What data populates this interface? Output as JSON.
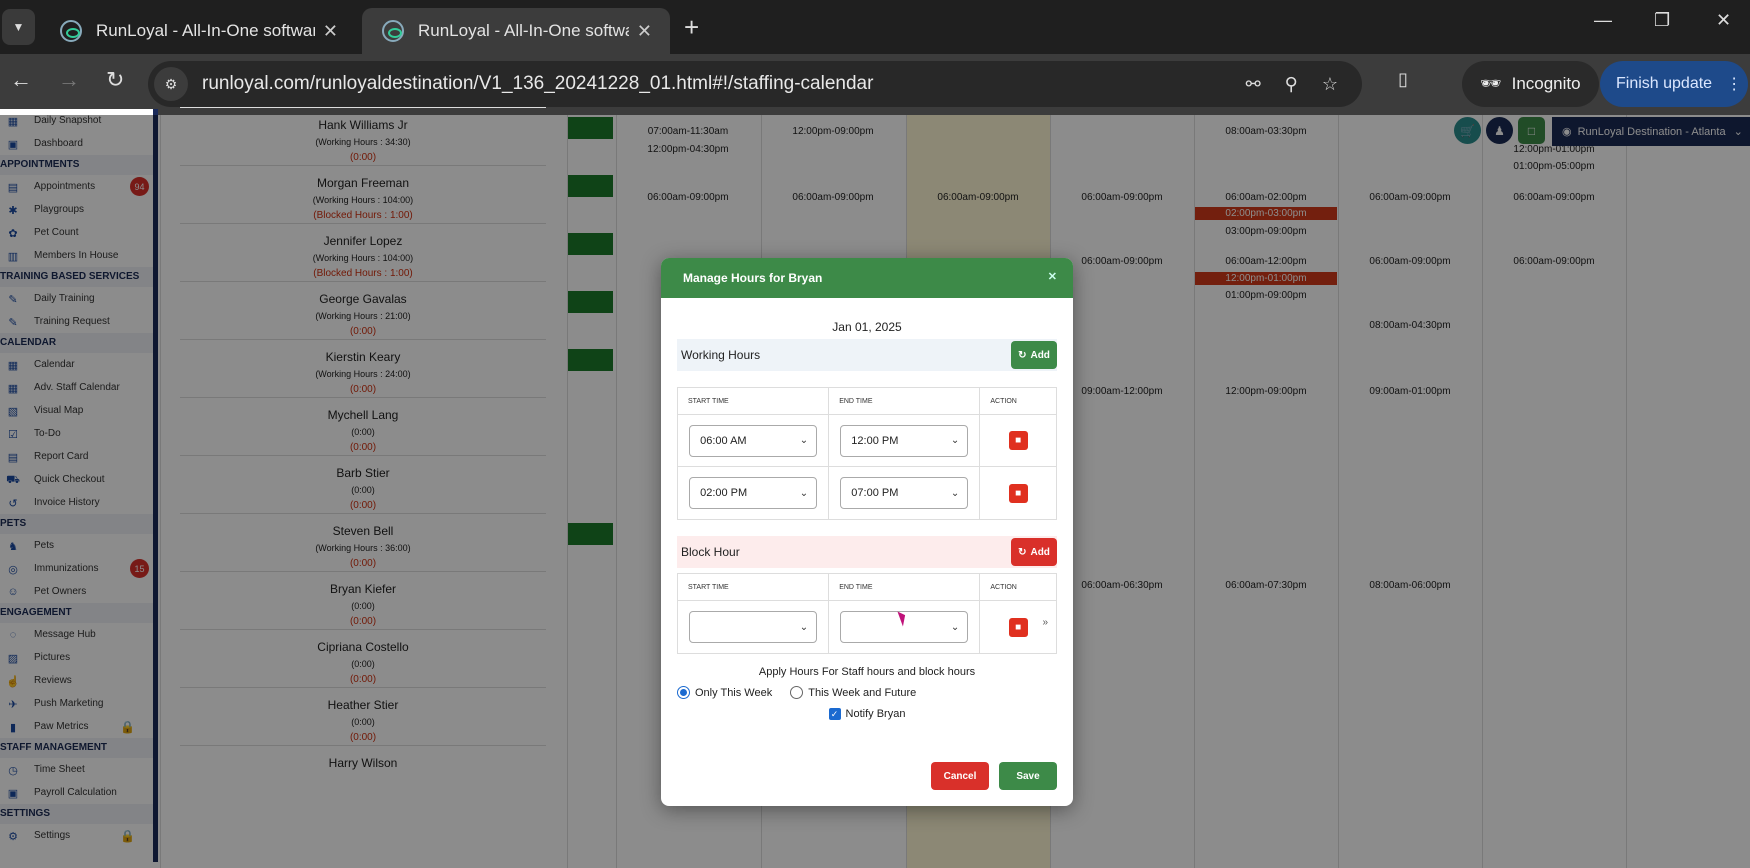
{
  "browser": {
    "tabs": [
      {
        "title": "RunLoyal - All-In-One software"
      },
      {
        "title": "RunLoyal - All-In-One software"
      }
    ],
    "url": "runloyal.com/runloyaldestination/V1_136_20241228_01.html#!/staffing-calendar",
    "incognito_label": "Incognito",
    "finish_update_label": "Finish update"
  },
  "location": "RunLoyal Destination - Atlanta",
  "sidebar": {
    "items": [
      {
        "label": "Daily Snapshot",
        "icon": "snapshot-icon"
      },
      {
        "label": "Dashboard",
        "icon": "dashboard-icon"
      },
      {
        "section": "APPOINTMENTS"
      },
      {
        "label": "Appointments",
        "icon": "appointments-icon",
        "badge": "94"
      },
      {
        "label": "Playgroups",
        "icon": "playgroups-icon"
      },
      {
        "label": "Pet Count",
        "icon": "pet-count-icon"
      },
      {
        "label": "Members In House",
        "icon": "members-icon"
      },
      {
        "section": "TRAINING BASED SERVICES"
      },
      {
        "label": "Daily Training",
        "icon": "training-icon"
      },
      {
        "label": "Training Request",
        "icon": "training-request-icon"
      },
      {
        "section": "CALENDAR"
      },
      {
        "label": "Calendar",
        "icon": "calendar-icon"
      },
      {
        "label": "Adv. Staff Calendar",
        "icon": "staff-calendar-icon"
      },
      {
        "label": "Visual Map",
        "icon": "map-icon"
      },
      {
        "label": "To-Do",
        "icon": "todo-icon"
      },
      {
        "label": "Report Card",
        "icon": "report-card-icon"
      },
      {
        "label": "Quick Checkout",
        "icon": "checkout-icon"
      },
      {
        "label": "Invoice History",
        "icon": "invoice-icon"
      },
      {
        "section": "PETS"
      },
      {
        "label": "Pets",
        "icon": "pets-icon"
      },
      {
        "label": "Immunizations",
        "icon": "immunizations-icon",
        "badge": "15"
      },
      {
        "label": "Pet Owners",
        "icon": "pet-owners-icon"
      },
      {
        "section": "ENGAGEMENT"
      },
      {
        "label": "Message Hub",
        "icon": "message-icon"
      },
      {
        "label": "Pictures",
        "icon": "pictures-icon"
      },
      {
        "label": "Reviews",
        "icon": "reviews-icon"
      },
      {
        "label": "Push Marketing",
        "icon": "marketing-icon"
      },
      {
        "label": "Paw Metrics",
        "icon": "metrics-icon",
        "locked": true
      },
      {
        "section": "STAFF MANAGEMENT"
      },
      {
        "label": "Time Sheet",
        "icon": "timesheet-icon"
      },
      {
        "label": "Payroll Calculation",
        "icon": "payroll-icon"
      },
      {
        "section": "SETTINGS"
      },
      {
        "label": "Settings",
        "icon": "settings-icon",
        "locked": true
      }
    ]
  },
  "staff": [
    {
      "name": "Hank Williams Jr",
      "hours": "(Working Hours : 34:30)",
      "blocked": "(0:00)"
    },
    {
      "name": "Morgan Freeman",
      "hours": "(Working Hours : 104:00)",
      "blocked": "(Blocked Hours : 1:00)"
    },
    {
      "name": "Jennifer Lopez",
      "hours": "(Working Hours : 104:00)",
      "blocked": "(Blocked Hours : 1:00)"
    },
    {
      "name": "George Gavalas",
      "hours": "(Working Hours : 21:00)",
      "blocked": "(0:00)"
    },
    {
      "name": "Kierstin Keary",
      "hours": "(Working Hours : 24:00)",
      "blocked": "(0:00)"
    },
    {
      "name": "Mychell Lang",
      "hours": "(0:00)",
      "blocked": "(0:00)"
    },
    {
      "name": "Barb Stier",
      "hours": "(0:00)",
      "blocked": "(0:00)"
    },
    {
      "name": "Steven Bell",
      "hours": "(Working Hours : 36:00)",
      "blocked": "(0:00)"
    },
    {
      "name": "Bryan Kiefer",
      "hours": "(0:00)",
      "blocked": "(0:00)"
    },
    {
      "name": "Cipriana Costello",
      "hours": "(0:00)",
      "blocked": "(0:00)"
    },
    {
      "name": "Heather Stier",
      "hours": "(0:00)",
      "blocked": "(0:00)"
    },
    {
      "name": "Harry Wilson",
      "hours": "",
      "blocked": ""
    }
  ],
  "cells": {
    "r0": [
      "07:00am-11:30am",
      "12:00pm-04:30pm",
      "12:00pm-09:00pm",
      "08:00am-03:30pm",
      "12:00pm-01:00pm",
      "01:00pm-05:00pm"
    ],
    "r1": [
      "06:00am-09:00pm",
      "06:00am-09:00pm",
      "06:00am-09:00pm",
      "06:00am-09:00pm",
      "06:00am-02:00pm",
      "02:00pm-03:00pm",
      "03:00pm-09:00pm",
      "06:00am-09:00pm",
      "06:00am-09:00pm"
    ],
    "r2": [
      "06:00am-09:00pm",
      "06:00am-12:00pm",
      "12:00pm-01:00pm",
      "01:00pm-09:00pm",
      "06:00am-09:00pm",
      "06:00am-09:00pm"
    ],
    "r3": [
      "08:00am-04:30pm"
    ],
    "r4": [
      "09:00am-12:00pm",
      "12:00pm-09:00pm",
      "09:00am-01:00pm"
    ],
    "r7": [
      "06:00am-06:30pm",
      "06:00am-07:30pm",
      "08:00am-06:00pm"
    ],
    "partial": [
      "06:",
      "12",
      "08"
    ]
  },
  "modal": {
    "title": "Manage Hours for Bryan",
    "date": "Jan 01, 2025",
    "working_hours_label": "Working Hours",
    "add_label": "Add",
    "block_hour_label": "Block Hour",
    "col_start": "START TIME",
    "col_end": "END TIME",
    "col_action": "ACTION",
    "working_rows": [
      {
        "start": "06:00 AM",
        "end": "12:00 PM"
      },
      {
        "start": "02:00 PM",
        "end": "07:00 PM"
      }
    ],
    "apply_text": "Apply Hours For Staff hours and block hours",
    "option_this_week": "Only This Week",
    "option_future": "This Week and Future",
    "selected_option": "Only This Week",
    "notify_label": "Notify Bryan",
    "notify_checked": true,
    "cancel_label": "Cancel",
    "save_label": "Save"
  }
}
